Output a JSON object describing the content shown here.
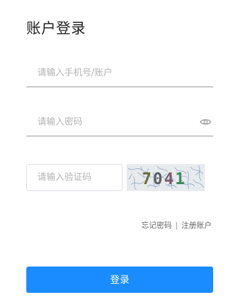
{
  "login": {
    "title": "账户登录",
    "account_placeholder": "请输入手机号/账户",
    "password_placeholder": "请输入密码",
    "captcha_placeholder": "请输入验证码",
    "captcha_code": "7041",
    "forgot_password": "忘记密码",
    "separator": "|",
    "register": "注册账户",
    "submit_label": "登录"
  },
  "colors": {
    "accent": "#1a8cff",
    "input_border": "#dcdfe6",
    "underline": "#9a9a9a"
  },
  "icons": {
    "password_toggle": "eye-icon"
  }
}
